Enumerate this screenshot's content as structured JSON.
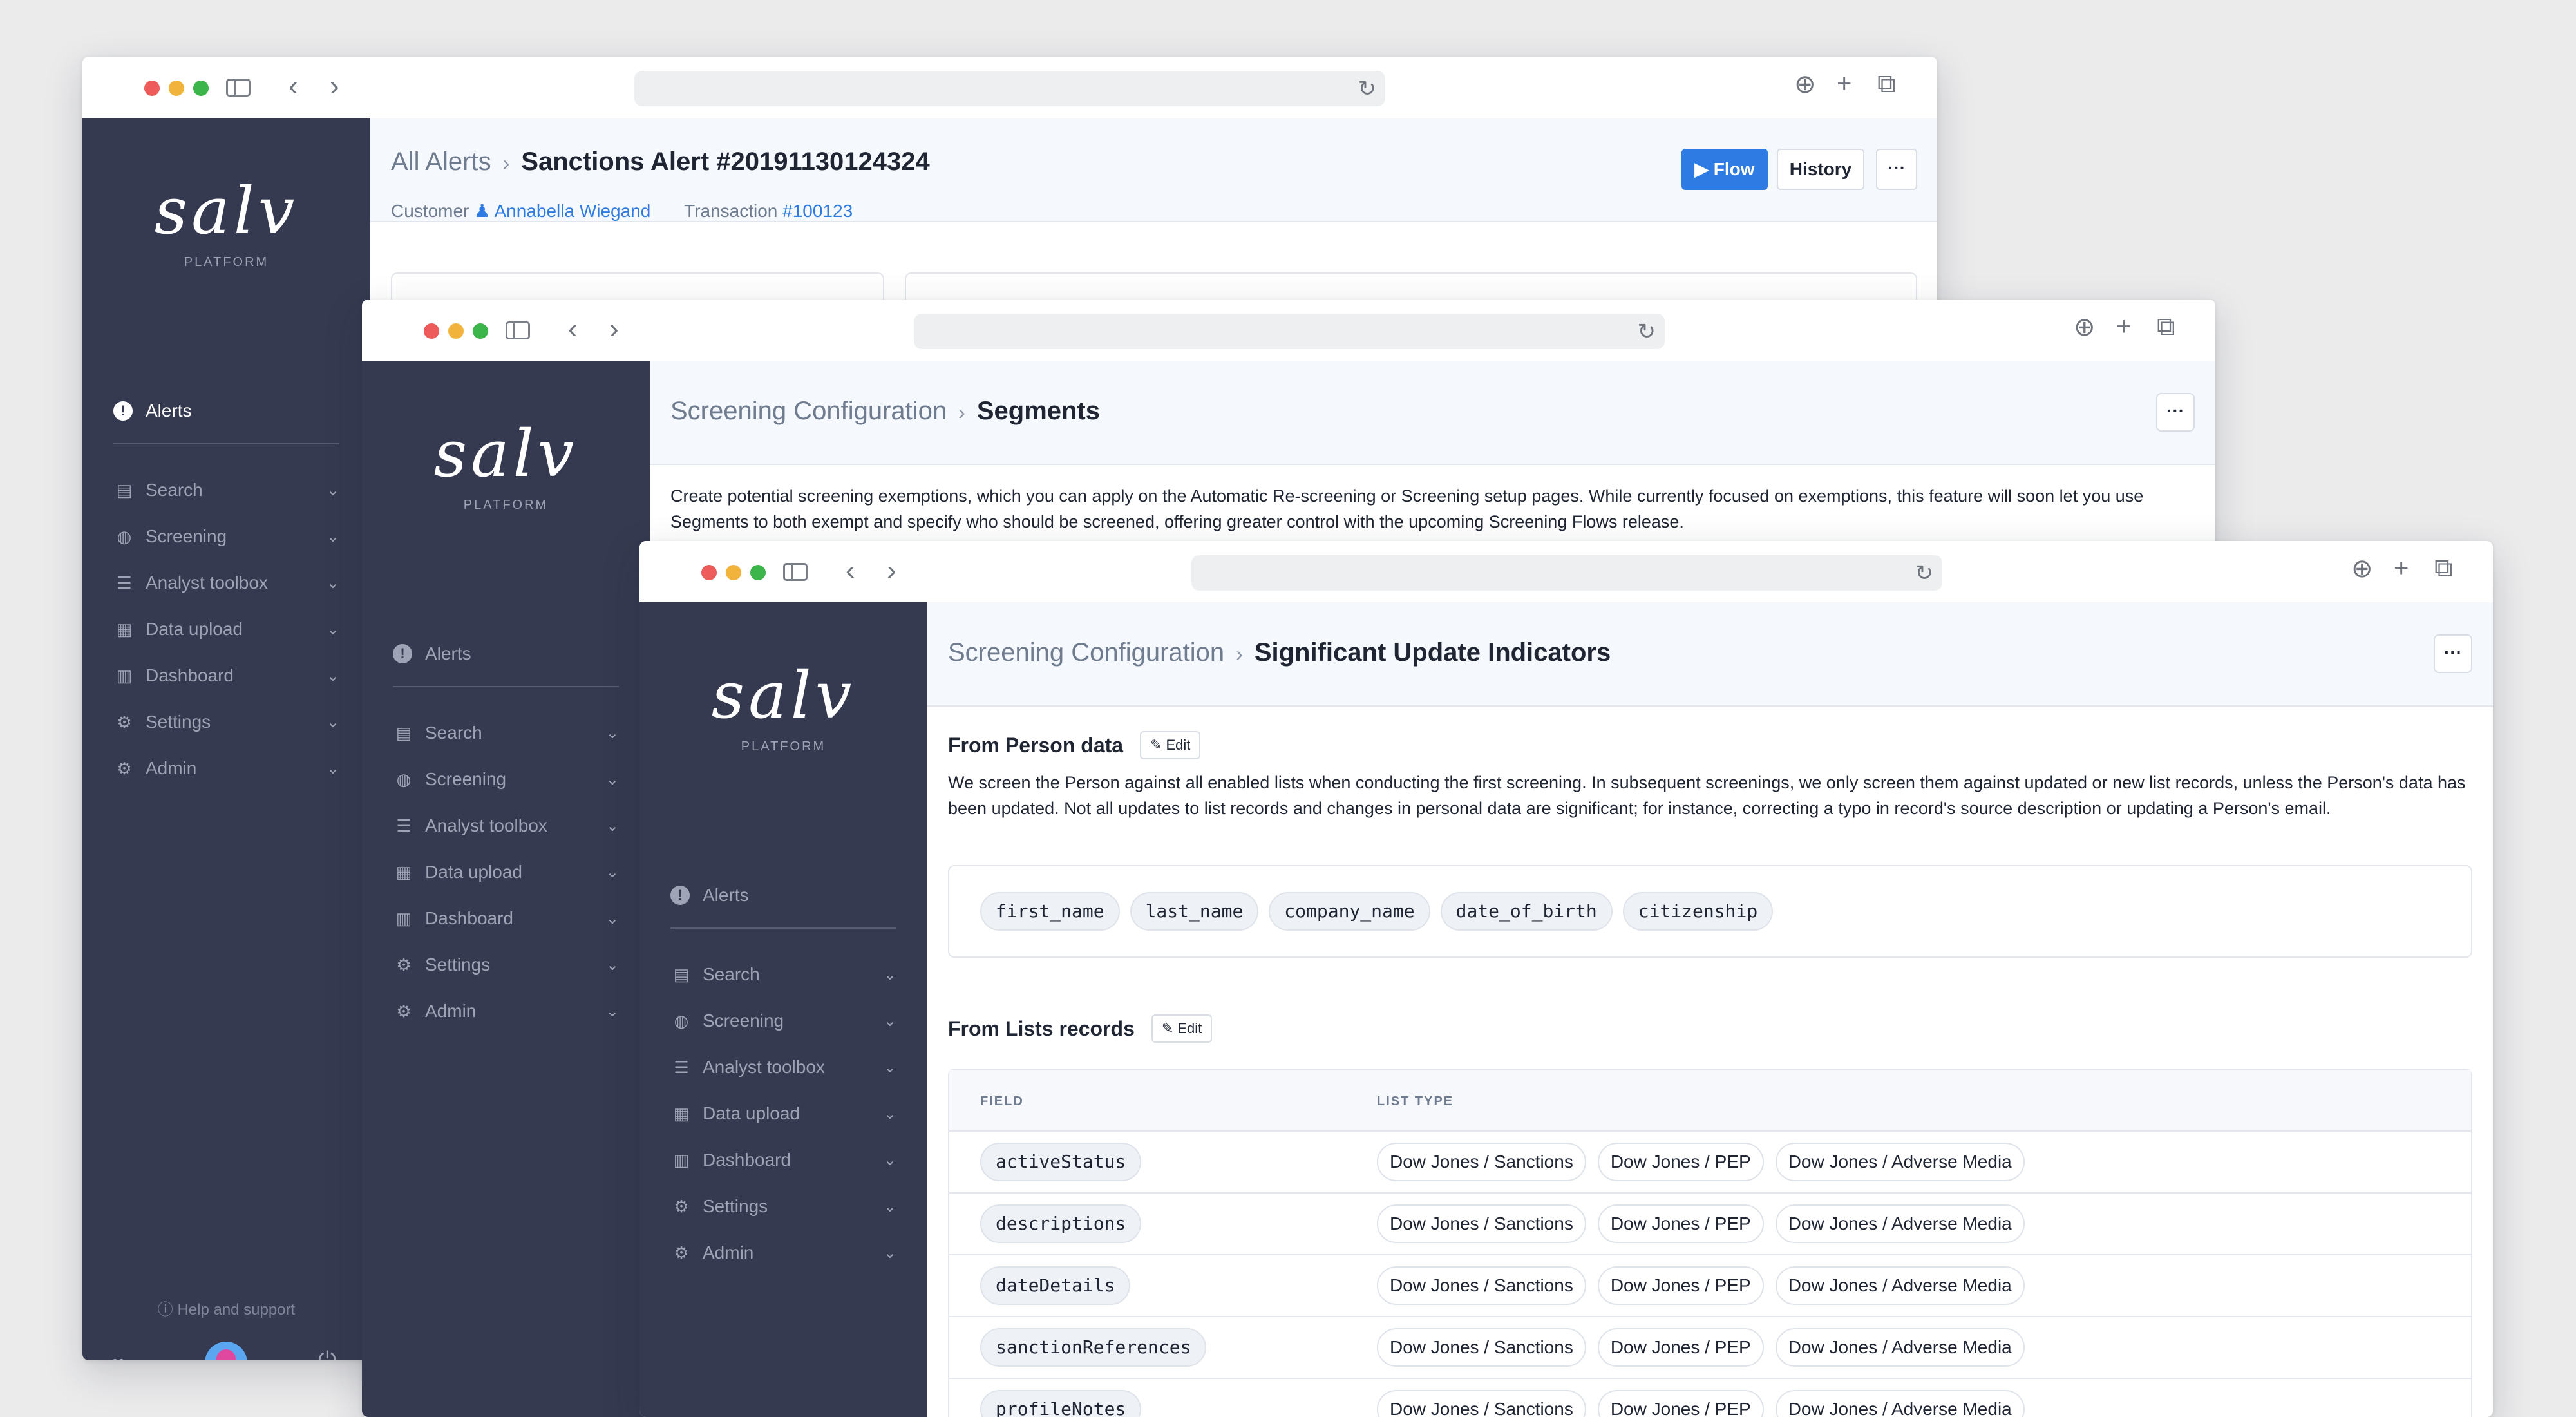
{
  "logo": {
    "text": "salv",
    "subtitle": "PLATFORM"
  },
  "nav": {
    "alerts": "Alerts",
    "items": [
      {
        "label": "Search",
        "icon": "id-card-icon"
      },
      {
        "label": "Screening",
        "icon": "globe-icon"
      },
      {
        "label": "Analyst toolbox",
        "icon": "sliders-icon"
      },
      {
        "label": "Data upload",
        "icon": "boxes-icon"
      },
      {
        "label": "Dashboard",
        "icon": "bar-chart-icon"
      },
      {
        "label": "Settings",
        "icon": "gear-icon"
      },
      {
        "label": "Admin",
        "icon": "gears-icon"
      }
    ],
    "help": "Help and support"
  },
  "win1": {
    "breadcrumb_parent": "All Alerts",
    "breadcrumb_current": "Sanctions Alert #20191130124324",
    "customer_label": "Customer",
    "customer_name": "Annabella Wiegand",
    "transaction_label": "Transaction",
    "transaction_id": "#100123",
    "flow_button": "Flow",
    "history_button": "History",
    "more": "···"
  },
  "win2": {
    "breadcrumb_parent": "Screening Configuration",
    "breadcrumb_current": "Segments",
    "description": "Create potential screening exemptions, which you can apply on the Automatic Re-screening or Screening setup pages. While currently focused on exemptions, this feature will soon let you use Segments to both exempt and specify who should be screened, offering greater control with the upcoming Screening Flows release.",
    "more": "···"
  },
  "win3": {
    "breadcrumb_parent": "Screening Configuration",
    "breadcrumb_current": "Significant Update Indicators",
    "more": "···",
    "person_section": {
      "title": "From Person data",
      "edit": "Edit",
      "description": "We screen the Person against all enabled lists when conducting the first screening. In subsequent screenings, we only screen them against updated or new list records, unless the Person's data has been updated. Not all updates to list records and changes in personal data are significant; for instance, correcting a typo in record's source description or updating a Person's email.",
      "fields": [
        "first_name",
        "last_name",
        "company_name",
        "date_of_birth",
        "citizenship"
      ]
    },
    "lists_section": {
      "title": "From Lists records",
      "edit": "Edit",
      "columns": [
        "FIELD",
        "LIST TYPE"
      ],
      "rows": [
        {
          "field": "activeStatus",
          "types": [
            "Dow Jones / Sanctions",
            "Dow Jones / PEP",
            "Dow Jones / Adverse Media"
          ]
        },
        {
          "field": "descriptions",
          "types": [
            "Dow Jones / Sanctions",
            "Dow Jones / PEP",
            "Dow Jones / Adverse Media"
          ]
        },
        {
          "field": "dateDetails",
          "types": [
            "Dow Jones / Sanctions",
            "Dow Jones / PEP",
            "Dow Jones / Adverse Media"
          ]
        },
        {
          "field": "sanctionReferences",
          "types": [
            "Dow Jones / Sanctions",
            "Dow Jones / PEP",
            "Dow Jones / Adverse Media"
          ]
        },
        {
          "field": "profileNotes",
          "types": [
            "Dow Jones / Sanctions",
            "Dow Jones / PEP",
            "Dow Jones / Adverse Media"
          ]
        }
      ]
    }
  },
  "colors": {
    "sidebar": "#363a50",
    "accent": "#2e7ce3",
    "header_bg": "#f5f8fd"
  }
}
